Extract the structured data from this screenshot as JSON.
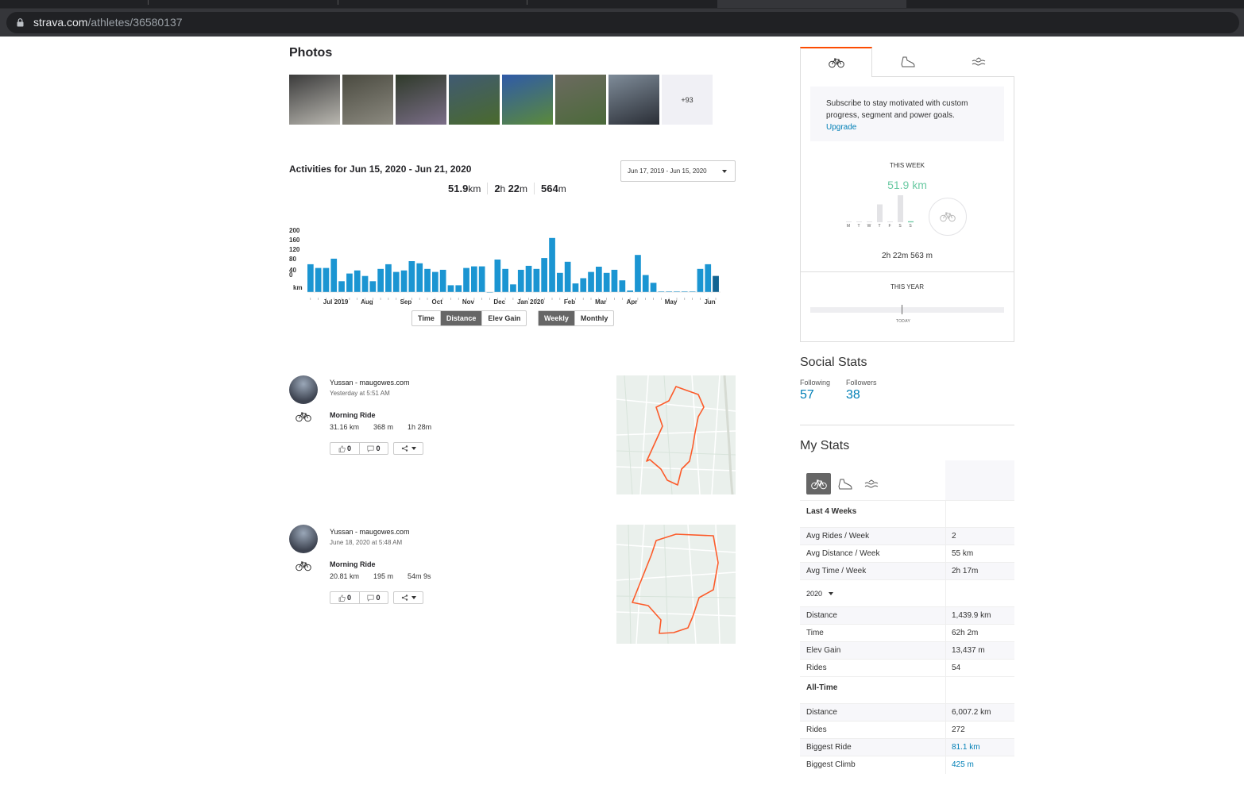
{
  "browser": {
    "url_domain": "strava.com",
    "url_path": "/athletes/36580137"
  },
  "photos": {
    "title": "Photos",
    "more_label": "+93",
    "thumb_colors": [
      [
        "#3b3b3b",
        "#b9b7b0"
      ],
      [
        "#4a4a40",
        "#8c8a80"
      ],
      [
        "#2f3a2a",
        "#7b6e88"
      ],
      [
        "#405a73",
        "#4a6a2c"
      ],
      [
        "#2f5aa8",
        "#5b8a3a"
      ],
      [
        "#6c6a60",
        "#4b6a3a"
      ],
      [
        "#7f8c99",
        "#2a2e36"
      ]
    ]
  },
  "activities": {
    "title": "Activities for Jun 15, 2020 - Jun 21, 2020",
    "date_range": "Jun 17, 2019 - Jun 15, 2020",
    "distance_value": "51.9",
    "distance_unit": "km",
    "time_h": "2",
    "time_h_unit": "h ",
    "time_m": "22",
    "time_m_unit": "m",
    "elev_value": "564",
    "elev_unit": "m",
    "toggles_metric": [
      "Time",
      "Distance",
      "Elev Gain"
    ],
    "metric_selected": "Distance",
    "toggles_period": [
      "Weekly",
      "Monthly"
    ],
    "period_selected": "Weekly"
  },
  "chart_data": {
    "type": "bar",
    "ylabel": "km",
    "y_ticks": [
      "200",
      "160",
      "120",
      "80",
      "40",
      "0"
    ],
    "ylim": [
      0,
      200
    ],
    "month_labels": [
      "Jul 2019",
      "Aug",
      "Sep",
      "Oct",
      "Nov",
      "Dec",
      "Jan 2020",
      "Feb",
      "Mar",
      "Apr",
      "May",
      "Jun"
    ],
    "values": [
      90,
      78,
      78,
      108,
      35,
      60,
      70,
      52,
      35,
      75,
      90,
      65,
      70,
      100,
      93,
      75,
      65,
      72,
      22,
      22,
      78,
      83,
      83,
      0,
      105,
      75,
      25,
      72,
      85,
      75,
      110,
      175,
      62,
      98,
      28,
      45,
      65,
      82,
      62,
      72,
      38,
      5,
      120,
      55,
      30,
      2,
      2,
      2,
      2,
      2,
      75,
      90,
      52
    ],
    "bar_color": "#1b95d2",
    "last_bar_color": "#0b3c5d"
  },
  "feed": [
    {
      "athlete": "Yussan - maugowes.com",
      "when": "Yesterday at 5:51 AM",
      "title": "Morning Ride",
      "distance": "31.16 km",
      "elevation": "368 m",
      "time": "1h 28m",
      "kudos": "0",
      "comments": "0"
    },
    {
      "athlete": "Yussan - maugowes.com",
      "when": "June 18, 2020 at 5:48 AM",
      "title": "Morning Ride",
      "distance": "20.81 km",
      "elevation": "195 m",
      "time": "54m 9s",
      "kudos": "0",
      "comments": "0"
    }
  ],
  "progress": {
    "subscribe_text": "Subscribe to stay motivated with custom progress, segment and power goals.",
    "upgrade_label": "Upgrade",
    "this_week_label": "THIS WEEK",
    "this_week_value": "51.9 km",
    "day_letters": [
      "M",
      "T",
      "W",
      "T",
      "F",
      "S",
      "S"
    ],
    "day_values": [
      0,
      0,
      0,
      9,
      0,
      14,
      0.5
    ],
    "this_week_time": "2h 22m 563 m",
    "this_year_label": "THIS YEAR",
    "today_label": "TODAY",
    "accent_color": "#6bcaa3"
  },
  "social": {
    "title": "Social Stats",
    "following_label": "Following",
    "following_count": "57",
    "followers_label": "Followers",
    "followers_count": "38"
  },
  "my_stats": {
    "title": "My Stats",
    "last4_label": "Last 4 Weeks",
    "last4": [
      {
        "k": "Avg Rides / Week",
        "v": "2"
      },
      {
        "k": "Avg Distance / Week",
        "v": "55 km"
      },
      {
        "k": "Avg Time / Week",
        "v": "2h 17m"
      }
    ],
    "year_label": "2020",
    "year": [
      {
        "k": "Distance",
        "v": "1,439.9 km"
      },
      {
        "k": "Time",
        "v": "62h 2m"
      },
      {
        "k": "Elev Gain",
        "v": "13,437 m"
      },
      {
        "k": "Rides",
        "v": "54"
      }
    ],
    "alltime_label": "All-Time",
    "alltime": [
      {
        "k": "Distance",
        "v": "6,007.2 km"
      },
      {
        "k": "Rides",
        "v": "272"
      },
      {
        "k": "Biggest Ride",
        "v": "81.1 km"
      },
      {
        "k": "Biggest Climb",
        "v": "425 m"
      }
    ]
  },
  "colors": {
    "strava_orange": "#fc4c02",
    "link_blue": "#007fb6",
    "route_orange": "#fc5b2a"
  }
}
